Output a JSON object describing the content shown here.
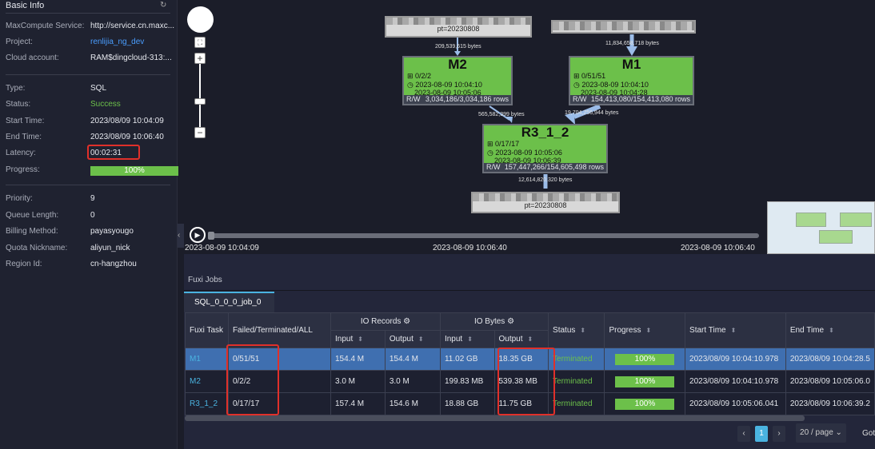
{
  "left_panel": {
    "title": "Basic Info",
    "group1": [
      {
        "label": "MaxCompute Service:",
        "value": "http://service.cn.maxc..."
      },
      {
        "label": "Project:",
        "value": "renlijia_ng_dev"
      },
      {
        "label": "Cloud account:",
        "value": "RAM$dingcloud-313:..."
      }
    ],
    "group2": [
      {
        "label": "Type:",
        "value": "SQL"
      },
      {
        "label": "Status:",
        "value": "Success"
      },
      {
        "label": "Start Time:",
        "value": "2023/08/09 10:04:09"
      },
      {
        "label": "End Time:",
        "value": "2023/08/09 10:06:40"
      },
      {
        "label": "Latency:",
        "value": "00:02:31"
      },
      {
        "label": "Progress:",
        "value": "100%"
      }
    ],
    "progress": 1.0,
    "group3": [
      {
        "label": "Priority:",
        "value": "9"
      },
      {
        "label": "Queue Length:",
        "value": "0"
      },
      {
        "label": "Billing Method:",
        "value": "payasyougo"
      },
      {
        "label": "Quota Nickname:",
        "value": "aliyun_nick"
      },
      {
        "label": "Region Id:",
        "value": "cn-hangzhou"
      }
    ]
  },
  "graph": {
    "nodes": {
      "M2": {
        "name": "M2",
        "instances": "0/2/2",
        "start": "2023-08-09 10:04:10",
        "end": "2023-08-09 10:05:06",
        "rw_label": "R/W",
        "rows": "3,034,186/3,034,186 rows"
      },
      "M1": {
        "name": "M1",
        "instances": "0/51/51",
        "start": "2023-08-09 10:04:10",
        "end": "2023-08-09 10:04:28",
        "rw_label": "R/W",
        "rows": "154,413,080/154,413,080 rows"
      },
      "R3": {
        "name": "R3_1_2",
        "instances": "0/17/17",
        "start": "2023-08-09 10:05:06",
        "end": "2023-08-09 10:06:39",
        "rw_label": "R/W",
        "rows": "157,447,266/154,605,498 rows"
      }
    },
    "sources": {
      "left_partition": "pt=20230808",
      "output_partition": "pt=20230808"
    },
    "edges": [
      "209,539,615 bytes",
      "11,834,658,718 bytes",
      "565,582,399 bytes",
      "19,704,256,944 bytes",
      "12,614,820,320 bytes"
    ],
    "timeline": {
      "start": "2023-08-09 10:04:09",
      "mid": "2023-08-09 10:06:40",
      "end": "2023-08-09 10:06:40"
    }
  },
  "jobs": {
    "section_title": "Fuxi Jobs",
    "tab": "SQL_0_0_0_job_0",
    "headers": {
      "task": "Fuxi Task",
      "fta": "Failed/Terminated/ALL",
      "io_records": "IO Records",
      "io_bytes": "IO Bytes",
      "input": "Input",
      "output": "Output",
      "status": "Status",
      "progress": "Progress",
      "start": "Start Time",
      "end": "End Time"
    },
    "rows": [
      {
        "task": "M1",
        "fta": "0/51/51",
        "rec_in": "154.4 M",
        "rec_out": "154.4 M",
        "bytes_in": "11.02 GB",
        "bytes_out": "18.35 GB",
        "status": "Terminated",
        "progress": "100%",
        "start": "2023/08/09 10:04:10.978",
        "end": "2023/08/09 10:04:28.5"
      },
      {
        "task": "M2",
        "fta": "0/2/2",
        "rec_in": "3.0 M",
        "rec_out": "3.0 M",
        "bytes_in": "199.83 MB",
        "bytes_out": "539.38 MB",
        "status": "Terminated",
        "progress": "100%",
        "start": "2023/08/09 10:04:10.978",
        "end": "2023/08/09 10:05:06.0"
      },
      {
        "task": "R3_1_2",
        "fta": "0/17/17",
        "rec_in": "157.4 M",
        "rec_out": "154.6 M",
        "bytes_in": "18.88 GB",
        "bytes_out": "11.75 GB",
        "status": "Terminated",
        "progress": "100%",
        "start": "2023/08/09 10:05:06.041",
        "end": "2023/08/09 10:06:39.2"
      }
    ],
    "pagination": {
      "page": "1",
      "page_size": "20 / page",
      "goto": "Got"
    }
  },
  "colors": {
    "success": "#6cc04a",
    "selected_row": "#3f6fb0",
    "highlight": "#e0302a"
  }
}
